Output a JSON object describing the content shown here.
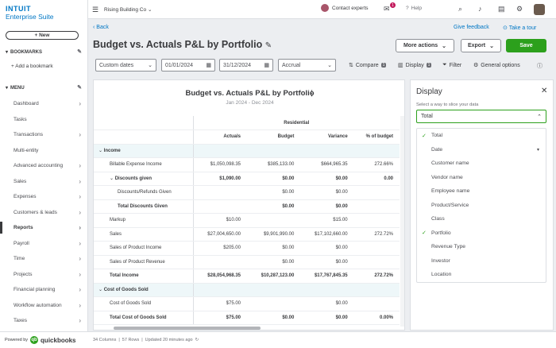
{
  "brand": {
    "line1": "INTUIT",
    "line2": "Enterprise Suite"
  },
  "sidebar": {
    "new_label": "+ New",
    "bookmarks_label": "BOOKMARKS",
    "add_bookmark": "+ Add a bookmark",
    "menu_label": "MENU",
    "items": [
      {
        "label": "Dashboard",
        "chev": true
      },
      {
        "label": "Tasks",
        "chev": false
      },
      {
        "label": "Transactions",
        "chev": true
      },
      {
        "label": "Multi-entity",
        "chev": false
      },
      {
        "label": "Advanced accounting",
        "chev": true
      },
      {
        "label": "Sales",
        "chev": true
      },
      {
        "label": "Expenses",
        "chev": true
      },
      {
        "label": "Customers & leads",
        "chev": true
      },
      {
        "label": "Reports",
        "chev": true,
        "active": true
      },
      {
        "label": "Payroll",
        "chev": true
      },
      {
        "label": "Time",
        "chev": true
      },
      {
        "label": "Projects",
        "chev": true
      },
      {
        "label": "Financial planning",
        "chev": true
      },
      {
        "label": "Workflow automation",
        "chev": true
      },
      {
        "label": "Taxes",
        "chev": true
      }
    ],
    "powered_by": "Powered by",
    "qb_text": "quickbooks"
  },
  "topbar": {
    "company": "Rising Building Co",
    "contact": "Contact experts",
    "badge": "1",
    "help": "Help"
  },
  "page": {
    "back": "Back",
    "feedback": "Give feedback",
    "tour": "Take a tour",
    "title": "Budget vs. Actuals P&L by Portfolio",
    "more_actions": "More actions",
    "export": "Export",
    "save": "Save"
  },
  "filters": {
    "date_range": "Custom dates",
    "start": "01/01/2024",
    "end": "31/12/2024",
    "basis": "Accrual",
    "compare": "Compare",
    "compare_count": "1",
    "display": "Display",
    "display_count": "1",
    "filter": "Filter",
    "general_options": "General options"
  },
  "report": {
    "title": "Budget vs. Actuals P&L by Portfolio",
    "dates": "Jan 2024 - Dec 2024",
    "group_header": "Residential",
    "columns": [
      "Actuals",
      "Budget",
      "Variance",
      "% of budget"
    ],
    "rows": [
      {
        "label": "Income",
        "type": "section",
        "values": [
          "",
          "",
          "",
          ""
        ]
      },
      {
        "label": "Billable Expense Income",
        "type": "item",
        "indent": 1,
        "values": [
          "$1,050,098.35",
          "$385,133.00",
          "$664,965.35",
          "272.66%"
        ]
      },
      {
        "label": "Discounts given",
        "type": "group",
        "indent": 1,
        "values": [
          "$1,090.00",
          "$0.00",
          "$0.00",
          "0.00"
        ]
      },
      {
        "label": "Discounts/Refunds Given",
        "type": "item",
        "indent": 2,
        "values": [
          "",
          "$0.00",
          "$0.00",
          ""
        ]
      },
      {
        "label": "Total Discounts Given",
        "type": "total",
        "indent": 2,
        "values": [
          "",
          "$0.00",
          "$0.00",
          ""
        ]
      },
      {
        "label": "Markup",
        "type": "item",
        "indent": 1,
        "values": [
          "$10.00",
          "",
          "$15.00",
          ""
        ]
      },
      {
        "label": "Sales",
        "type": "item",
        "indent": 1,
        "values": [
          "$27,004,650.00",
          "$9,901,990.00",
          "$17,102,660.00",
          "272.72%"
        ]
      },
      {
        "label": "Sales of Product Income",
        "type": "item",
        "indent": 1,
        "values": [
          "$205.00",
          "$0.00",
          "$0.00",
          ""
        ]
      },
      {
        "label": "Sales of Product Revenue",
        "type": "item",
        "indent": 1,
        "values": [
          "",
          "$0.00",
          "$0.00",
          ""
        ]
      },
      {
        "label": "Total Income",
        "type": "total",
        "indent": 1,
        "values": [
          "$28,054,968.35",
          "$10,287,123.00",
          "$17,767,845.35",
          "272.72%"
        ]
      },
      {
        "label": "Cost of Goods Sold",
        "type": "section",
        "values": [
          "",
          "",
          "",
          ""
        ]
      },
      {
        "label": "Cost of Goods Sold",
        "type": "item",
        "indent": 1,
        "values": [
          "$75.00",
          "",
          "$0.00",
          ""
        ]
      },
      {
        "label": "Total Cost of Goods Sold",
        "type": "total",
        "indent": 1,
        "values": [
          "$75.00",
          "$0.00",
          "$0.00",
          "0.00%"
        ]
      }
    ]
  },
  "display_panel": {
    "title": "Display",
    "hint": "Select a way to slice your data",
    "selected": "Total",
    "options": [
      {
        "label": "Total",
        "checked": true
      },
      {
        "label": "Date",
        "expandable": true
      },
      {
        "label": "Customer name"
      },
      {
        "label": "Vendor name"
      },
      {
        "label": "Employee name"
      },
      {
        "label": "Product/Service"
      },
      {
        "label": "Class"
      },
      {
        "label": "Portfolio",
        "checked": true
      },
      {
        "label": "Revenue Type"
      },
      {
        "label": "Investor"
      },
      {
        "label": "Location"
      }
    ]
  },
  "footer": {
    "columns": "34 Columns",
    "rows": "57 Rows",
    "updated": "Updated 20 minutes ago"
  }
}
